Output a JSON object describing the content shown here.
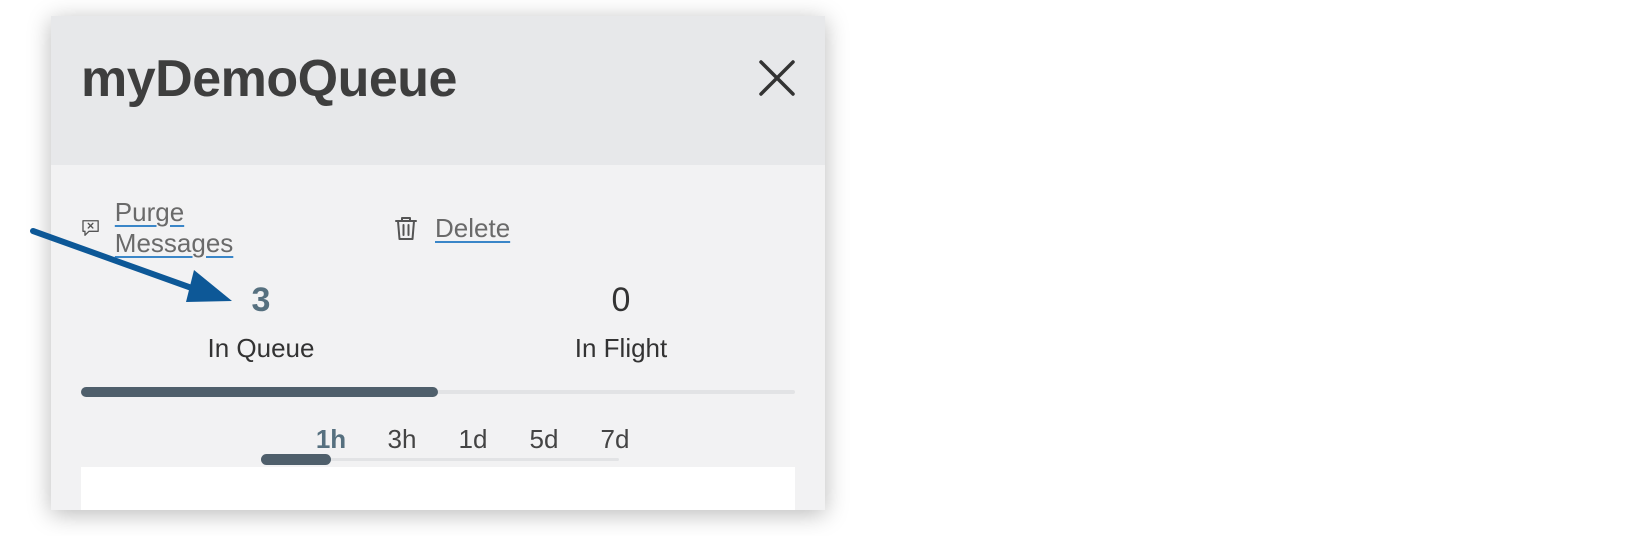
{
  "panel": {
    "title": "myDemoQueue",
    "close_icon": "close-icon"
  },
  "actions": {
    "purge": {
      "label": "Purge Messages",
      "icon": "message-x-icon"
    },
    "delete": {
      "label": "Delete",
      "icon": "trash-icon"
    }
  },
  "stats": {
    "in_queue": {
      "value": "3",
      "label": "In Queue"
    },
    "in_flight": {
      "value": "0",
      "label": "In Flight"
    }
  },
  "stats_tab": {
    "selected": "In Queue",
    "fill_fraction": 0.5
  },
  "time_ranges": {
    "options": [
      "1h",
      "3h",
      "1d",
      "5d",
      "7d"
    ],
    "selected": "1h"
  },
  "colors": {
    "accent": "#56707f",
    "link_underline": "#3a86c8",
    "annotation_arrow": "#0d5897"
  }
}
